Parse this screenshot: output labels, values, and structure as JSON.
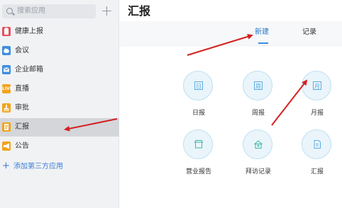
{
  "sidebar": {
    "search_placeholder": "搜索应用",
    "add_symbol": "+",
    "items": [
      {
        "label": "健康上报",
        "icon": "health-report-icon",
        "color": "#e8505b"
      },
      {
        "label": "会议",
        "icon": "cloud-meeting-icon",
        "color": "#3e8ee0"
      },
      {
        "label": "企业邮箱",
        "icon": "mail-icon",
        "color": "#3e8ee0"
      },
      {
        "label": "直播",
        "icon": "live-icon",
        "color": "#f2a31b",
        "icon_text": "LIVE"
      },
      {
        "label": "审批",
        "icon": "approval-stamp-icon",
        "color": "#f2a31b"
      },
      {
        "label": "汇报",
        "icon": "report-icon",
        "color": "#f2a31b"
      },
      {
        "label": "公告",
        "icon": "megaphone-icon",
        "color": "#f2a31b"
      }
    ],
    "add_app_label": "添加第三方应用",
    "accent": "#3a7fd8"
  },
  "main": {
    "title": "汇报",
    "tabs": [
      {
        "label": "新建",
        "selected": true
      },
      {
        "label": "记录",
        "selected": false
      }
    ],
    "apps": [
      {
        "label": "日报",
        "icon": "daily-report-icon",
        "glyph": "日"
      },
      {
        "label": "周报",
        "icon": "weekly-report-icon",
        "glyph": "周"
      },
      {
        "label": "月报",
        "icon": "monthly-report-icon",
        "glyph": "月"
      },
      {
        "label": "营业报告",
        "icon": "store-icon"
      },
      {
        "label": "拜访记录",
        "icon": "house-visit-icon"
      },
      {
        "label": "汇报",
        "icon": "document-icon"
      }
    ]
  },
  "annotation_color": "#d42020"
}
